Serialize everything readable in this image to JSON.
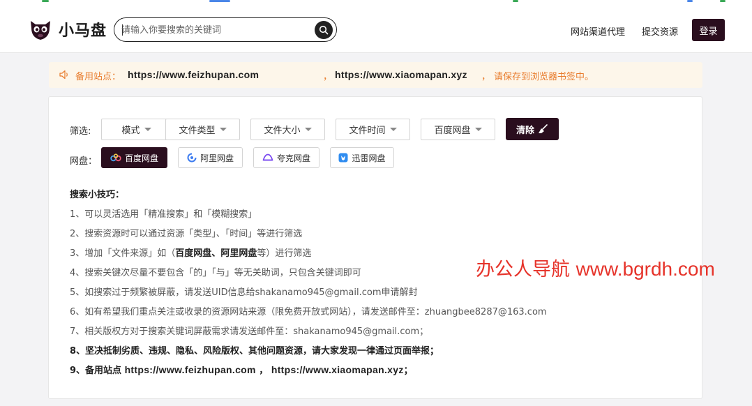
{
  "header": {
    "brand": "小马盘",
    "search_placeholder": "请输入你要搜索的关键词",
    "nav_agent": "网站渠道代理",
    "nav_submit": "提交资源",
    "login_label": "登录"
  },
  "notice": {
    "prefix": "备用站点：",
    "url1": "https://www.feizhupan.com",
    "sep1": "，",
    "url2": "https://www.xiaomapan.xyz",
    "sep2": "，",
    "suffix": "请保存到浏览器书签中。"
  },
  "filters": {
    "label": "筛选:",
    "items": [
      "模式",
      "文件类型",
      "文件大小",
      "文件时间",
      "百度网盘"
    ],
    "clear_label": "清除"
  },
  "disks": {
    "label": "网盘：",
    "items": [
      "百度网盘",
      "阿里网盘",
      "夸克网盘",
      "迅雷网盘"
    ]
  },
  "tips": {
    "title": "搜索小技巧：",
    "t1": "1、可以灵活选用「精准搜索」和「模糊搜索」",
    "t2": "2、搜索资源时可以通过资源「类型」、「时间」等进行筛选",
    "t3_a": "3、增加「文件来源」如（",
    "t3_b": "百度网盘",
    "t3_c": "、",
    "t3_d": "阿里网盘",
    "t3_e": "等）进行筛选",
    "t4": "4、搜索关键次尽量不要包含「的」「与」等无关助词，只包含关键词即可",
    "t5": "5、如搜索过于频繁被屏蔽，请发送UID信息给shakanamo945@gmail.com申请解封",
    "t6": "6、如有希望我们重点关注或收录的资源网站来源（限免费开放式网站），请发送邮件至：zhuangbee8287@163.com",
    "t7": "7、相关版权方对于搜索关键词屏蔽需求请发送邮件至：shakanamo945@gmail.com；",
    "t8": "8、坚决抵制劣质、违规、隐私、风险版权、其他问题资源，请大家发现一律通过页面举报；",
    "t9_a": "9、备用站点 ",
    "t9_b": "https://www.feizhupan.com",
    "t9_c": " ， ",
    "t9_d": "https://www.xiaomapan.xyz",
    "t9_e": "；"
  },
  "watermark": {
    "cn": "办公人导航",
    "en": "www.bgrdh.com"
  },
  "colors": {
    "brand_dark": "#2a0e1e",
    "notice_orange": "#e87a2a",
    "notice_bg": "#fdf6ea",
    "watermark_red": "#e6332a"
  }
}
